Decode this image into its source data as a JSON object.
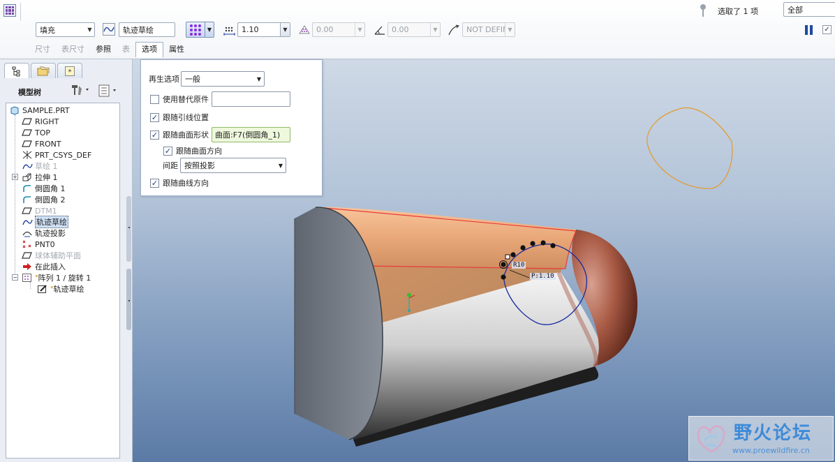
{
  "dashboard": {
    "type_combo": "填充",
    "sketch_ref": "轨迹草绘",
    "spacing_value": "1.10",
    "density_value": "0.00",
    "angle_value": "0.00",
    "extent_value": "NOT DEFINED",
    "tabs": [
      "尺寸",
      "表尺寸",
      "参照",
      "表",
      "选项",
      "属性"
    ],
    "active_tab": "选项",
    "selection_status": "选取了 1 项",
    "filter": "全部"
  },
  "left_panel": {
    "tree_title": "模型树",
    "tree_items": [
      {
        "label": "SAMPLE.PRT",
        "icon": "part-icon",
        "state": "normal"
      },
      {
        "label": "RIGHT",
        "icon": "datum-plane-icon",
        "state": "normal"
      },
      {
        "label": "TOP",
        "icon": "datum-plane-icon",
        "state": "normal"
      },
      {
        "label": "FRONT",
        "icon": "datum-plane-icon",
        "state": "normal"
      },
      {
        "label": "PRT_CSYS_DEF",
        "icon": "csys-icon",
        "state": "normal"
      },
      {
        "label": "草绘 1",
        "icon": "sketch-icon",
        "state": "hidden"
      },
      {
        "label": "拉伸 1",
        "icon": "extrude-icon",
        "state": "normal"
      },
      {
        "label": "倒圆角 1",
        "icon": "round-icon",
        "state": "normal"
      },
      {
        "label": "倒圆角 2",
        "icon": "round-icon",
        "state": "normal"
      },
      {
        "label": "DTM1",
        "icon": "datum-plane-icon",
        "state": "hidden"
      },
      {
        "label": "轨迹草绘",
        "icon": "sketch-icon",
        "state": "selected"
      },
      {
        "label": "轨迹投影",
        "icon": "projection-icon",
        "state": "normal"
      },
      {
        "label": "PNT0",
        "icon": "datum-point-icon",
        "state": "normal"
      },
      {
        "label": "球体辅助平面",
        "icon": "datum-plane-icon",
        "state": "hidden"
      },
      {
        "label": "在此插入",
        "icon": "insert-arrow-icon",
        "state": "normal"
      },
      {
        "label": "阵列 1 / 旋转 1",
        "icon": "pattern-icon",
        "state": "normal"
      },
      {
        "label": "轨迹草绘",
        "icon": "sketch-edit-icon",
        "state": "child"
      }
    ]
  },
  "options_panel": {
    "regen_label": "再生选项",
    "regen_value": "一般",
    "use_alt_origin_label": "使用替代原件",
    "use_alt_origin_checked": false,
    "follow_leader_label": "跟随引线位置",
    "follow_leader_checked": true,
    "follow_surface_label": "跟随曲面形状",
    "follow_surface_checked": true,
    "surface_ref": "曲面:F7(倒圆角_1)",
    "follow_surface_dir_label": "跟随曲面方向",
    "follow_surface_dir_checked": true,
    "spacing_label": "间距",
    "spacing_value": "按照投影",
    "follow_curve_dir_label": "跟随曲线方向",
    "follow_curve_dir_checked": true
  },
  "graphics": {
    "dim_radius": "R10",
    "dim_spacing": "1.10"
  },
  "watermark": {
    "title": "野火论坛",
    "url": "www.proewildfire.cn"
  }
}
